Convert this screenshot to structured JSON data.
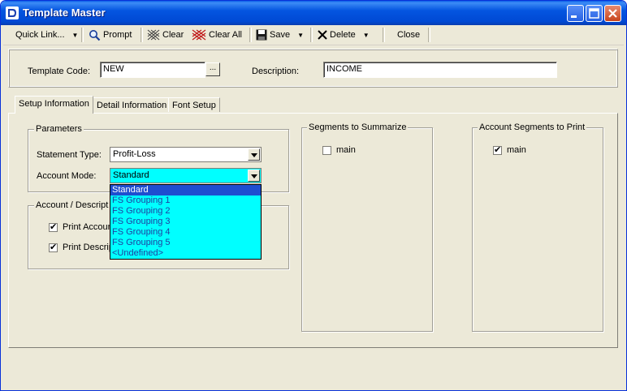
{
  "window": {
    "title": "Template Master"
  },
  "toolbar": {
    "quick_link": "Quick Link...",
    "prompt": "Prompt",
    "clear": "Clear",
    "clear_all": "Clear All",
    "save": "Save",
    "delete": "Delete",
    "close": "Close"
  },
  "header": {
    "template_code_label": "Template Code:",
    "template_code_value": "NEW",
    "ellipsis": "...",
    "description_label": "Description:",
    "description_value": "INCOME"
  },
  "tabs": [
    {
      "label": "Setup Information",
      "active": true
    },
    {
      "label": "Detail Information",
      "active": false
    },
    {
      "label": "Font Setup",
      "active": false
    }
  ],
  "parameters": {
    "legend": "Parameters",
    "statement_type_label": "Statement Type:",
    "statement_type_value": "Profit-Loss",
    "account_mode_label": "Account Mode:",
    "account_mode_value": "Standard"
  },
  "account_mode_options": [
    "Standard",
    "FS Grouping 1",
    "FS Grouping 2",
    "FS Grouping 3",
    "FS Grouping 4",
    "FS Grouping 5",
    "<Undefined>"
  ],
  "account_description": {
    "legend": "Account / Descript",
    "print_account_label": "Print Accoun",
    "print_account_checked": true,
    "print_description_label": "Print Descrip",
    "print_description_checked": true
  },
  "segments_summarize": {
    "legend": "Segments to Summarize",
    "items": [
      {
        "label": "main",
        "checked": false
      }
    ]
  },
  "segments_print": {
    "legend": "Account Segments to Print",
    "items": [
      {
        "label": "main",
        "checked": true
      }
    ]
  },
  "colors": {
    "titlebar": "#0055e5",
    "dropdown_bg": "#00ffff",
    "dropdown_selected": "#1e4ed0",
    "window_bg": "#ece9d8"
  }
}
